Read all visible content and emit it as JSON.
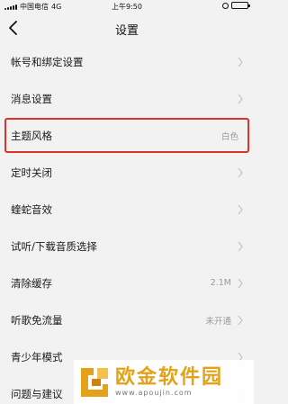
{
  "status_bar": {
    "carrier": "中国电信",
    "network": "4G",
    "time": "上午9:50",
    "battery_level": 0.8
  },
  "nav": {
    "title": "设置",
    "back_icon": "chevron-left-icon"
  },
  "settings": {
    "items": [
      {
        "label": "帐号和绑定设置",
        "value": ""
      },
      {
        "label": "消息设置",
        "value": ""
      },
      {
        "label": "主题风格",
        "value": "白色",
        "highlighted": true
      },
      {
        "label": "定时关闭",
        "value": ""
      },
      {
        "label": "蝰蛇音效",
        "value": ""
      },
      {
        "label": "试听/下载音质选择",
        "value": ""
      },
      {
        "label": "清除缓存",
        "value": "2.1M"
      },
      {
        "label": "听歌免流量",
        "value": "未开通"
      },
      {
        "label": "青少年模式",
        "value": ""
      },
      {
        "label": "问题与建议",
        "value": ""
      }
    ]
  },
  "watermark": {
    "name": "欧金软件园",
    "url": "www.apoujin.com"
  },
  "colors": {
    "background": "#f2f2f2",
    "highlight": "#d9342b",
    "secondary_text": "#9a9a9a",
    "watermark": "#e3a21a"
  }
}
